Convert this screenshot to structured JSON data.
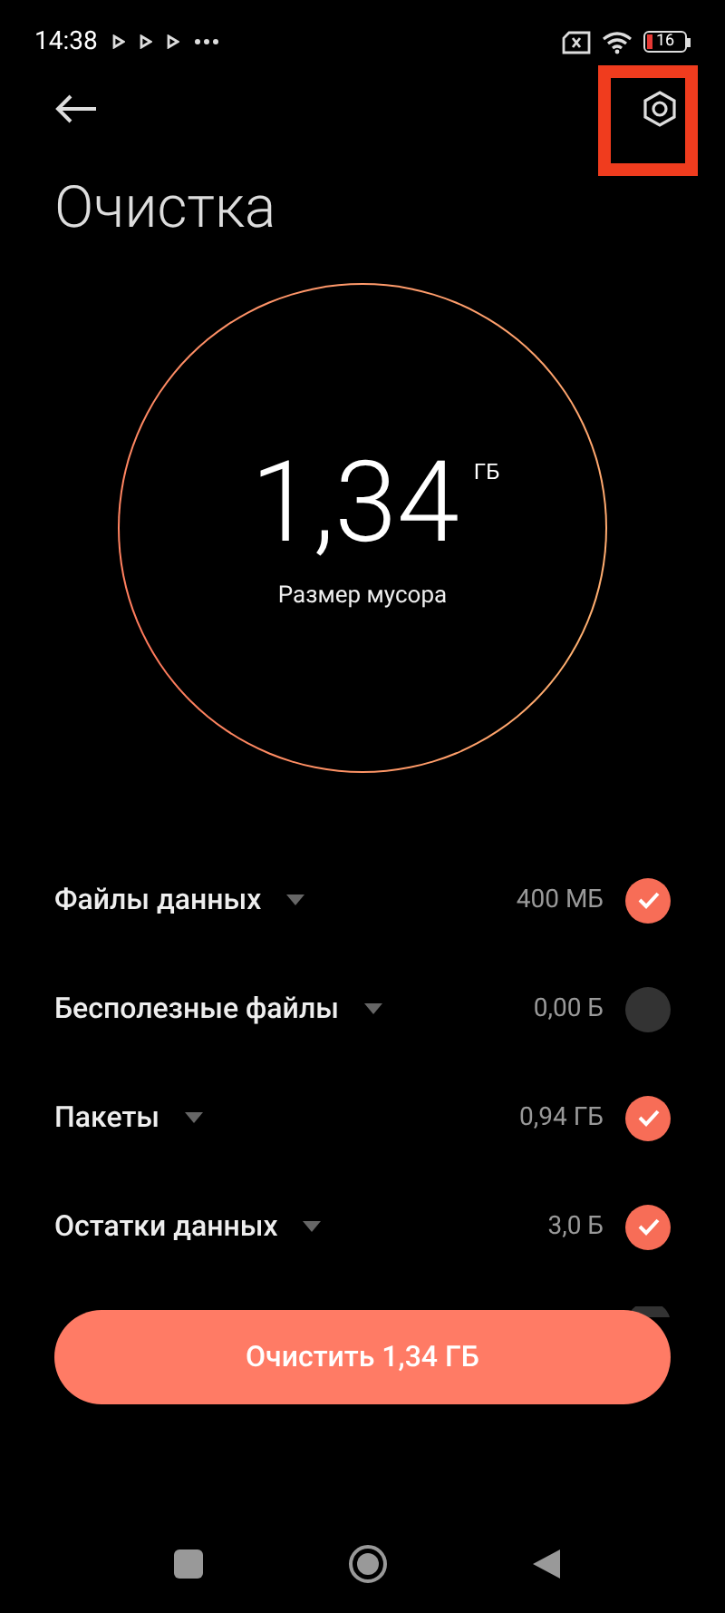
{
  "status_bar": {
    "time": "14:38",
    "battery": "16"
  },
  "title": "Очистка",
  "summary": {
    "value": "1,34",
    "unit": "ГБ",
    "caption": "Размер мусора"
  },
  "items": [
    {
      "label": "Файлы данных",
      "size": "400 МБ",
      "checked": true
    },
    {
      "label": "Бесполезные файлы",
      "size": "0,00 Б",
      "checked": false
    },
    {
      "label": "Пакеты",
      "size": "0,94 ГБ",
      "checked": true
    },
    {
      "label": "Остатки данных",
      "size": "3,0 Б",
      "checked": true
    }
  ],
  "cut_off_item": {
    "checked": false
  },
  "clean_button": "Очистить 1,34 ГБ"
}
